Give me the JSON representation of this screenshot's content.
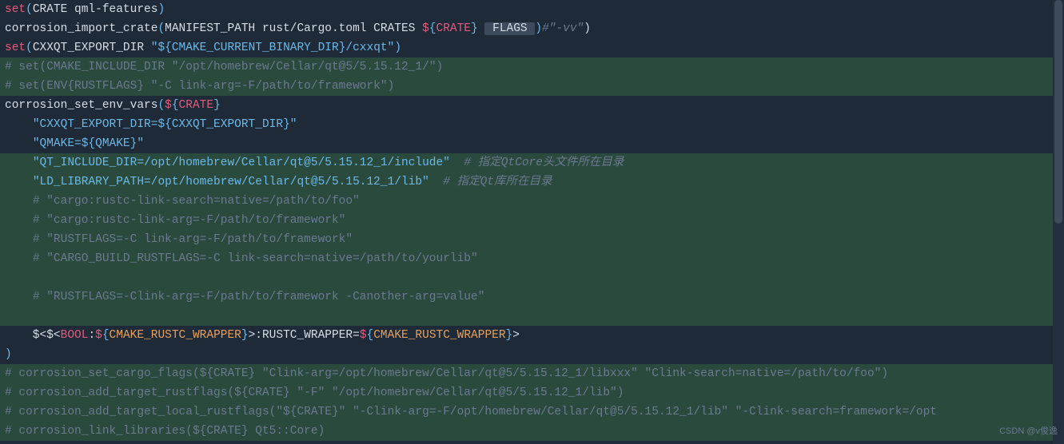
{
  "watermark": "CSDN @v俊逸",
  "lines": [
    {
      "hl": false,
      "segs": [
        {
          "c": "kw",
          "t": "set"
        },
        {
          "c": "punct-blue",
          "t": "("
        },
        {
          "c": "ident",
          "t": "CRATE qml-features"
        },
        {
          "c": "punct-blue",
          "t": ")"
        }
      ]
    },
    {
      "hl": false,
      "segs": [
        {
          "c": "fn",
          "t": "corrosion_import_crate"
        },
        {
          "c": "punct-blue",
          "t": "("
        },
        {
          "c": "ident",
          "t": "MANIFEST_PATH rust/Cargo.toml CRATES "
        },
        {
          "c": "dollar",
          "t": "$"
        },
        {
          "c": "var2",
          "t": "{"
        },
        {
          "c": "var",
          "t": "CRATE"
        },
        {
          "c": "var2",
          "t": "}"
        },
        {
          "c": "ident",
          "t": " "
        },
        {
          "c": "flags",
          "t": " FLAGS "
        },
        {
          "c": "punct-blue",
          "t": ")"
        },
        {
          "c": "cmt",
          "t": "#\"-vv\""
        },
        {
          "c": "punct",
          "t": ")"
        }
      ]
    },
    {
      "hl": false,
      "segs": [
        {
          "c": "kw",
          "t": "set"
        },
        {
          "c": "punct-blue",
          "t": "("
        },
        {
          "c": "ident",
          "t": "CXXQT_EXPORT_DIR "
        },
        {
          "c": "str",
          "t": "\"${CMAKE_CURRENT_BINARY_DIR}/cxxqt\""
        },
        {
          "c": "punct-blue",
          "t": ")"
        }
      ]
    },
    {
      "hl": true,
      "segs": [
        {
          "c": "cmt2",
          "t": "# set(CMAKE_INCLUDE_DIR \"/opt/homebrew/Cellar/qt@5/5.15.12_1/\")"
        }
      ]
    },
    {
      "hl": true,
      "segs": [
        {
          "c": "cmt2",
          "t": "# set(ENV{RUSTFLAGS} \"-C link-arg=-F/path/to/framework\")"
        }
      ]
    },
    {
      "hl": false,
      "segs": [
        {
          "c": "fn",
          "t": "corrosion_set_env_vars"
        },
        {
          "c": "punct-blue",
          "t": "("
        },
        {
          "c": "dollar",
          "t": "$"
        },
        {
          "c": "var2",
          "t": "{"
        },
        {
          "c": "var",
          "t": "CRATE"
        },
        {
          "c": "var2",
          "t": "}"
        }
      ]
    },
    {
      "hl": false,
      "segs": [
        {
          "c": "ident",
          "t": "    "
        },
        {
          "c": "str",
          "t": "\"CXXQT_EXPORT_DIR=${CXXQT_EXPORT_DIR}\""
        }
      ]
    },
    {
      "hl": false,
      "segs": [
        {
          "c": "ident",
          "t": "    "
        },
        {
          "c": "str",
          "t": "\"QMAKE=${QMAKE}\""
        }
      ]
    },
    {
      "hl": true,
      "segs": [
        {
          "c": "ident",
          "t": "    "
        },
        {
          "c": "str",
          "t": "\"QT_INCLUDE_DIR=/opt/homebrew/Cellar/qt@5/5.15.12_1/include\""
        },
        {
          "c": "ident",
          "t": "  "
        },
        {
          "c": "cmt",
          "t": "# 指定QtCore头文件所在目录"
        }
      ]
    },
    {
      "hl": true,
      "segs": [
        {
          "c": "ident",
          "t": "    "
        },
        {
          "c": "str",
          "t": "\"LD_LIBRARY_PATH=/opt/homebrew/Cellar/qt@5/5.15.12_1/lib\""
        },
        {
          "c": "ident",
          "t": "  "
        },
        {
          "c": "cmt",
          "t": "# 指定Qt库所在目录"
        }
      ]
    },
    {
      "hl": true,
      "segs": [
        {
          "c": "ident",
          "t": "    "
        },
        {
          "c": "cmt2",
          "t": "# \"cargo:rustc-link-search=native=/path/to/foo\""
        }
      ]
    },
    {
      "hl": true,
      "segs": [
        {
          "c": "ident",
          "t": "    "
        },
        {
          "c": "cmt2",
          "t": "# \"cargo:rustc-link-arg=-F/path/to/framework\""
        }
      ]
    },
    {
      "hl": true,
      "segs": [
        {
          "c": "ident",
          "t": "    "
        },
        {
          "c": "cmt2",
          "t": "# \"RUSTFLAGS=-C link-arg=-F/path/to/framework\""
        }
      ]
    },
    {
      "hl": true,
      "segs": [
        {
          "c": "ident",
          "t": "    "
        },
        {
          "c": "cmt2",
          "t": "# \"CARGO_BUILD_RUSTFLAGS=-C link-search=native=/path/to/yourlib\""
        }
      ]
    },
    {
      "hl": true,
      "segs": [
        {
          "c": "ident",
          "t": "    "
        }
      ]
    },
    {
      "hl": true,
      "segs": [
        {
          "c": "ident",
          "t": "    "
        },
        {
          "c": "cmt2",
          "t": "# \"RUSTFLAGS=-Clink-arg=-F/path/to/framework -Canother-arg=value\""
        }
      ]
    },
    {
      "hl": true,
      "segs": [
        {
          "c": "ident",
          "t": "    "
        }
      ]
    },
    {
      "hl": false,
      "segs": [
        {
          "c": "ident",
          "t": "    $<$<"
        },
        {
          "c": "boolkw",
          "t": "BOOL"
        },
        {
          "c": "ident",
          "t": ":"
        },
        {
          "c": "dollar",
          "t": "$"
        },
        {
          "c": "var2",
          "t": "{"
        },
        {
          "c": "gen",
          "t": "CMAKE_RUSTC_WRAPPER"
        },
        {
          "c": "var2",
          "t": "}"
        },
        {
          "c": "ident",
          "t": ">:RUSTC_WRAPPER="
        },
        {
          "c": "dollar",
          "t": "$"
        },
        {
          "c": "var2",
          "t": "{"
        },
        {
          "c": "gen",
          "t": "CMAKE_RUSTC_WRAPPER"
        },
        {
          "c": "var2",
          "t": "}"
        },
        {
          "c": "ident",
          "t": ">"
        }
      ]
    },
    {
      "hl": false,
      "segs": [
        {
          "c": "punct-blue",
          "t": ")"
        }
      ]
    },
    {
      "hl": true,
      "segs": [
        {
          "c": "cmt2",
          "t": "# corrosion_set_cargo_flags(${CRATE} \"Clink-arg=/opt/homebrew/Cellar/qt@5/5.15.12_1/libxxx\" \"Clink-search=native=/path/to/foo\")"
        }
      ]
    },
    {
      "hl": true,
      "segs": [
        {
          "c": "cmt2",
          "t": "# corrosion_add_target_rustflags(${CRATE} \"-F\" \"/opt/homebrew/Cellar/qt@5/5.15.12_1/lib\")"
        }
      ]
    },
    {
      "hl": true,
      "segs": [
        {
          "c": "cmt2",
          "t": "# corrosion_add_target_local_rustflags(\"${CRATE}\" \"-Clink-arg=-F/opt/homebrew/Cellar/qt@5/5.15.12_1/lib\" \"-Clink-search=framework=/opt"
        }
      ]
    },
    {
      "hl": true,
      "segs": [
        {
          "c": "cmt2",
          "t": "# corrosion_link_libraries(${CRATE} Qt5::Core)"
        }
      ]
    }
  ]
}
